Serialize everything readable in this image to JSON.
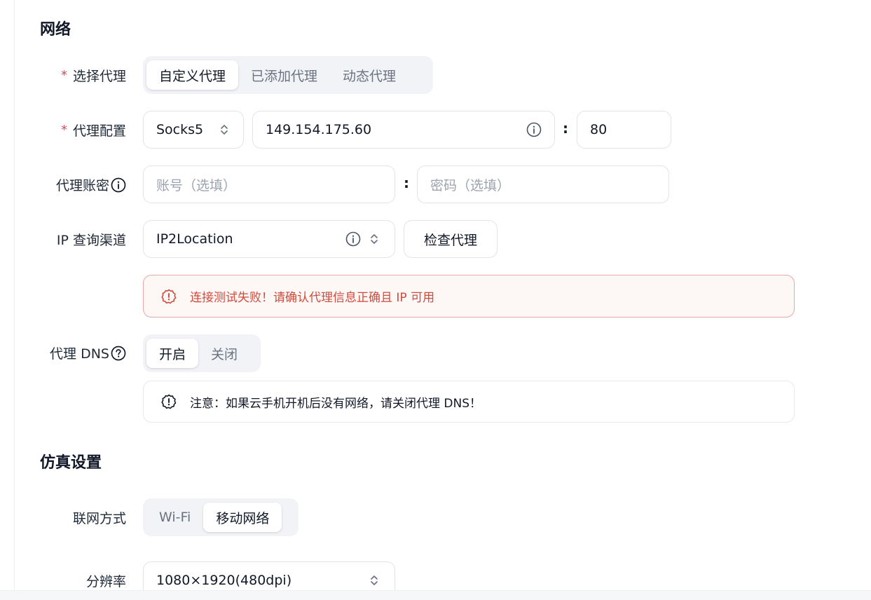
{
  "network": {
    "section_title": "网络",
    "proxy_select": {
      "label": "选择代理",
      "required_mark": "*",
      "options": [
        "自定义代理",
        "已添加代理",
        "动态代理"
      ],
      "selected_index": 0
    },
    "proxy_config": {
      "label": "代理配置",
      "required_mark": "*",
      "protocol": "Socks5",
      "host": "149.154.175.60",
      "separator": ":",
      "port": "80"
    },
    "proxy_auth": {
      "label": "代理账密",
      "username_placeholder": "账号（选填）",
      "separator": ":",
      "password_placeholder": "密码（选填）"
    },
    "ip_channel": {
      "label": "IP 查询渠道",
      "value": "IP2Location",
      "check_button": "检查代理"
    },
    "error_message": "连接测试失败！请确认代理信息正确且 IP 可用",
    "proxy_dns": {
      "label": "代理 DNS",
      "options": [
        "开启",
        "关闭"
      ],
      "selected_index": 0
    },
    "dns_note": "注意：如果云手机开机后没有网络，请关闭代理 DNS！"
  },
  "simulation": {
    "section_title": "仿真设置",
    "network_mode": {
      "label": "联网方式",
      "options": [
        "Wi-Fi",
        "移动网络"
      ],
      "selected_index": 1
    },
    "resolution": {
      "label": "分辨率",
      "value": "1080×1920(480dpi)"
    }
  },
  "colors": {
    "required": "#e5484d",
    "error": "#d14b3d",
    "error_border": "#e7a9a4"
  },
  "icons": [
    "info-icon",
    "question-icon",
    "chevron-updown-icon",
    "alert-icon"
  ]
}
